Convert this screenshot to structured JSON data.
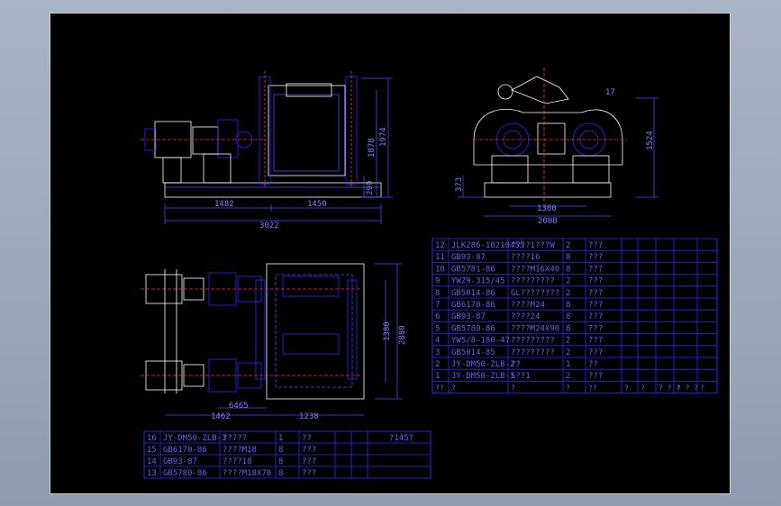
{
  "viewer": {
    "background": "#98a5b8",
    "sheet_color": "#000000",
    "line_colors": {
      "outline": "#ffffff",
      "dimension": "#4a4aff",
      "part": "#2a2aff",
      "accent": "#ff3030",
      "green": "#30c030"
    }
  },
  "dimensions": {
    "front_width_left": "1482",
    "front_width_right": "1450",
    "front_total": "3022",
    "front_height": "1974",
    "front_height_2": "1878",
    "front_base": "290",
    "side_width": "2000",
    "side_width_inner": "1300",
    "side_height": "1524",
    "side_low": "373",
    "side_mark": "17",
    "plan_height": "2880",
    "plan_height_inner": "1380",
    "plan_dim_left": "1462",
    "plan_dim_mid": "6465",
    "plan_dim_right": "1238"
  },
  "parts_table": {
    "rows": [
      {
        "no": "12",
        "code": "JLK286-10210455",
        "name": "????1???W",
        "qty": "2",
        "mat": "???"
      },
      {
        "no": "11",
        "code": "GB93-87",
        "name": "????16",
        "qty": "8",
        "mat": "???"
      },
      {
        "no": "10",
        "code": "GB5781-86",
        "name": "????M16X40",
        "qty": "8",
        "mat": "???"
      },
      {
        "no": "9",
        "code": "YWZ9-315/45",
        "name": "?????????",
        "qty": "2",
        "mat": "???"
      },
      {
        "no": "8",
        "code": "GB5014-86",
        "name": "GL????????",
        "qty": "2",
        "mat": "???"
      },
      {
        "no": "7",
        "code": "GB6170-86",
        "name": "????M24",
        "qty": "8",
        "mat": "???"
      },
      {
        "no": "6",
        "code": "GB93-87",
        "name": "????24",
        "qty": "8",
        "mat": "???"
      },
      {
        "no": "5",
        "code": "GB5780-86",
        "name": "????M24X90",
        "qty": "8",
        "mat": "???"
      },
      {
        "no": "4",
        "code": "YW5/8-180-47",
        "name": "?????????",
        "qty": "2",
        "mat": "???"
      },
      {
        "no": "3",
        "code": "GB5014-85",
        "name": "?????????",
        "qty": "2",
        "mat": "???"
      },
      {
        "no": "2",
        "code": "JY-DM50-ZLB-2",
        "name": "??",
        "qty": "1",
        "mat": "??"
      },
      {
        "no": "1",
        "code": "JY-DM50-ZLB-1",
        "name": "S??1",
        "qty": "2",
        "mat": "???"
      }
    ],
    "header": [
      "??",
      "?",
      "?",
      "?",
      "??",
      "?",
      "?",
      "? ? ?",
      "? ? ?",
      "?"
    ]
  },
  "lower_table": {
    "rows": [
      {
        "no": "16",
        "code": "JY-DM50-ZLB-3",
        "name": "?????",
        "qty": "1",
        "mat": "??",
        "note": "?145?"
      },
      {
        "no": "15",
        "code": "GB6170-86",
        "name": "????M18",
        "qty": "8",
        "mat": "???",
        "note": ""
      },
      {
        "no": "14",
        "code": "GB93-87",
        "name": "????18",
        "qty": "8",
        "mat": "???",
        "note": ""
      },
      {
        "no": "13",
        "code": "GB5780-86",
        "name": "????M18X70",
        "qty": "8",
        "mat": "???",
        "note": ""
      }
    ]
  }
}
